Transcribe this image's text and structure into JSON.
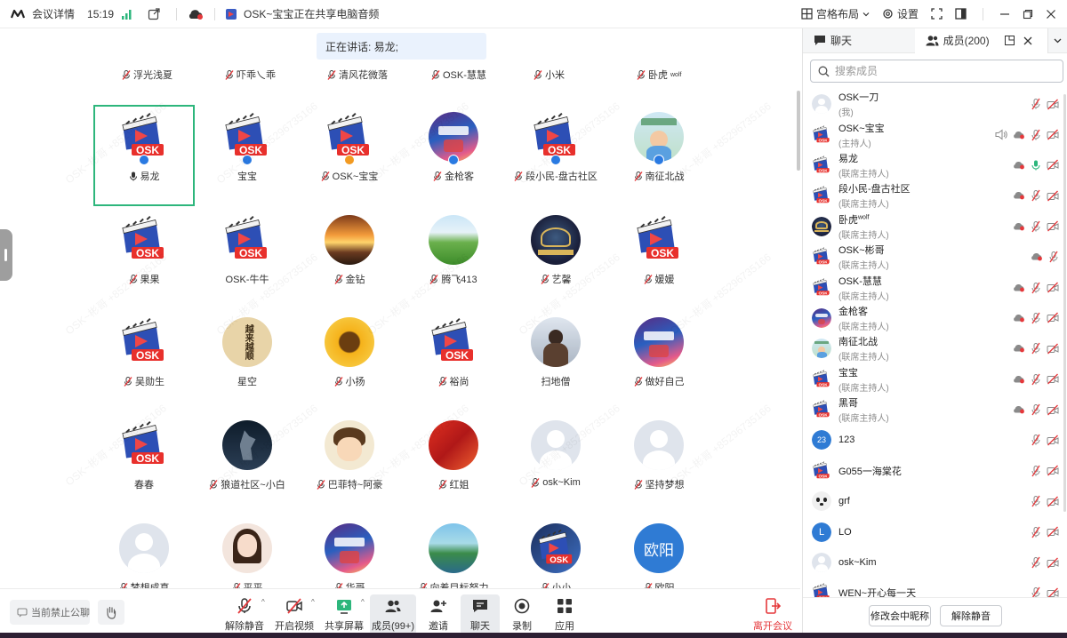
{
  "titlebar": {
    "app_name": "会议详情",
    "time": "15:19",
    "sharing_text": "OSK~宝宝正在共享电脑音频",
    "layout_label": "宫格布局",
    "settings_label": "设置"
  },
  "speaking": {
    "text": "正在讲话: 易龙;"
  },
  "top_row": [
    "浮光浅夏",
    "吓乖乀乖",
    "清风花微落",
    "OSK-慧慧",
    "小米",
    "卧虎"
  ],
  "top_row_sup": "wolf",
  "grid": [
    {
      "name": "易龙",
      "avatar": "osk",
      "mic": "speaking",
      "badge": "host",
      "active": true
    },
    {
      "name": "宝宝",
      "avatar": "osk",
      "mic": "none",
      "badge": "host"
    },
    {
      "name": "OSK~宝宝",
      "avatar": "osk",
      "mic": "muted",
      "badge": "host-orange"
    },
    {
      "name": "金枪客",
      "avatar": "game",
      "mic": "muted",
      "badge": "host"
    },
    {
      "name": "段小民-盘古社区",
      "avatar": "osk",
      "mic": "muted",
      "badge": "host"
    },
    {
      "name": "南征北战",
      "avatar": "photo-kid",
      "mic": "muted",
      "badge": "host"
    },
    {
      "name": "果果",
      "avatar": "osk",
      "mic": "muted"
    },
    {
      "name": "OSK-牛牛",
      "avatar": "osk",
      "mic": "none"
    },
    {
      "name": "金钻",
      "avatar": "sunset",
      "mic": "muted"
    },
    {
      "name": "腾飞413",
      "avatar": "tea",
      "mic": "muted"
    },
    {
      "name": "艺馨",
      "avatar": "dark-gold",
      "mic": "muted"
    },
    {
      "name": "媛媛",
      "avatar": "osk",
      "mic": "muted"
    },
    {
      "name": "吴勋生",
      "avatar": "osk",
      "mic": "muted"
    },
    {
      "name": "星空",
      "avatar": "scroll",
      "mic": "none"
    },
    {
      "name": "小扬",
      "avatar": "sunflower",
      "mic": "muted"
    },
    {
      "name": "裕尚",
      "avatar": "osk",
      "mic": "muted"
    },
    {
      "name": "扫地僧",
      "avatar": "person",
      "mic": "none"
    },
    {
      "name": "做好自己",
      "avatar": "game",
      "mic": "muted"
    },
    {
      "name": "春春",
      "avatar": "osk",
      "mic": "none"
    },
    {
      "name": "狼道社区~小白",
      "avatar": "wolf",
      "mic": "muted"
    },
    {
      "name": "巴菲特~阿豪",
      "avatar": "cartoon",
      "mic": "muted"
    },
    {
      "name": "红姐",
      "avatar": "leaves",
      "mic": "muted"
    },
    {
      "name": "osk~Kim",
      "avatar": "blank",
      "mic": "muted"
    },
    {
      "name": "坚持梦想",
      "avatar": "blank",
      "mic": "muted"
    },
    {
      "name": "梦想成真",
      "avatar": "blank",
      "mic": "muted"
    },
    {
      "name": "平平",
      "avatar": "girl",
      "mic": "muted"
    },
    {
      "name": "华哥",
      "avatar": "game",
      "mic": "muted"
    },
    {
      "name": "向着目标努力",
      "avatar": "landscape",
      "mic": "muted"
    },
    {
      "name": "小小",
      "avatar": "game-osk",
      "mic": "muted"
    },
    {
      "name": "欧阳",
      "avatar": "text-ouyang",
      "mic": "muted"
    }
  ],
  "avatar_text": {
    "ouyang": "欧阳",
    "scroll_text": "越来越顺"
  },
  "watermark": "OSK~彬哥 +85296735166",
  "bottombar": {
    "mute_all_chat": "当前禁止公聊",
    "unmute": "解除静音",
    "start_video": "开启视频",
    "share_screen": "共享屏幕",
    "members": "成员(99+)",
    "invite": "邀请",
    "chat": "聊天",
    "record": "录制",
    "apps": "应用",
    "leave": "离开会议"
  },
  "panel": {
    "tab_chat": "聊天",
    "tab_members": "成员(200)",
    "search_placeholder": "搜索成员",
    "members": [
      {
        "name": "OSK一刀",
        "role": "(我)",
        "avatar": "blank",
        "icons": [
          "mic-off-red",
          "cam-off"
        ]
      },
      {
        "name": "OSK~宝宝",
        "role": "(主持人)",
        "avatar": "osk",
        "icons": [
          "speaker",
          "cloud-red",
          "mic-off-red",
          "cam-off"
        ]
      },
      {
        "name": "易龙",
        "role": "(联席主持人)",
        "avatar": "osk",
        "icons": [
          "cloud-red",
          "mic-green",
          "cam-off"
        ]
      },
      {
        "name": "段小民-盘古社区",
        "role": "(联席主持人)",
        "avatar": "osk",
        "icons": [
          "cloud-red",
          "mic-off-red",
          "cam-off"
        ]
      },
      {
        "name": "卧虎",
        "sup": "wolf",
        "role": "(联席主持人)",
        "avatar": "dark-gold",
        "icons": [
          "cloud-red",
          "mic-off-red",
          "cam-off"
        ]
      },
      {
        "name": "OSK~彬哥",
        "role": "(联席主持人)",
        "avatar": "osk",
        "icons": [
          "cloud-red",
          "mic-off-red"
        ]
      },
      {
        "name": "OSK-慧慧",
        "role": "(联席主持人)",
        "avatar": "osk",
        "icons": [
          "cloud-red",
          "mic-off-red",
          "cam-off"
        ]
      },
      {
        "name": "金枪客",
        "role": "(联席主持人)",
        "avatar": "game",
        "icons": [
          "cloud-red",
          "mic-off-red",
          "cam-off"
        ]
      },
      {
        "name": "南征北战",
        "role": "(联席主持人)",
        "avatar": "photo-kid",
        "icons": [
          "cloud-red",
          "mic-off-red",
          "cam-off"
        ]
      },
      {
        "name": "宝宝",
        "role": "(联席主持人)",
        "avatar": "osk",
        "icons": [
          "cloud-red",
          "mic-off-red",
          "cam-off"
        ]
      },
      {
        "name": "黑哥",
        "role": "(联席主持人)",
        "avatar": "osk",
        "icons": [
          "cloud-red",
          "mic-off-red",
          "cam-off"
        ]
      },
      {
        "name": "123",
        "role": "",
        "avatar": "num-123",
        "icons": [
          "mic-off-red",
          "cam-off"
        ]
      },
      {
        "name": "G055一海棠花",
        "role": "",
        "avatar": "osk",
        "icons": [
          "mic-off-red",
          "cam-off"
        ]
      },
      {
        "name": "grf",
        "role": "",
        "avatar": "panda",
        "icons": [
          "mic-off-red",
          "cam-off"
        ]
      },
      {
        "name": "LO",
        "role": "",
        "avatar": "letter-L",
        "icons": [
          "mic-off-red",
          "cam-off"
        ]
      },
      {
        "name": "osk~Kim",
        "role": "",
        "avatar": "blank",
        "icons": [
          "mic-off-red",
          "cam-off"
        ]
      },
      {
        "name": "WEN~开心每一天",
        "role": "",
        "avatar": "osk",
        "icons": [
          "mic-off-red",
          "cam-off"
        ]
      }
    ],
    "avatar_labels": {
      "num": "23",
      "letter": "L"
    },
    "edit_nickname": "修改会中昵称",
    "unmute_button": "解除静音"
  },
  "colors": {
    "accent_blue": "#2a7ae2",
    "active_green": "#2db67c",
    "leave_red": "#e5383b",
    "muted_red": "#e5383b",
    "mic_green": "#2db67c"
  }
}
